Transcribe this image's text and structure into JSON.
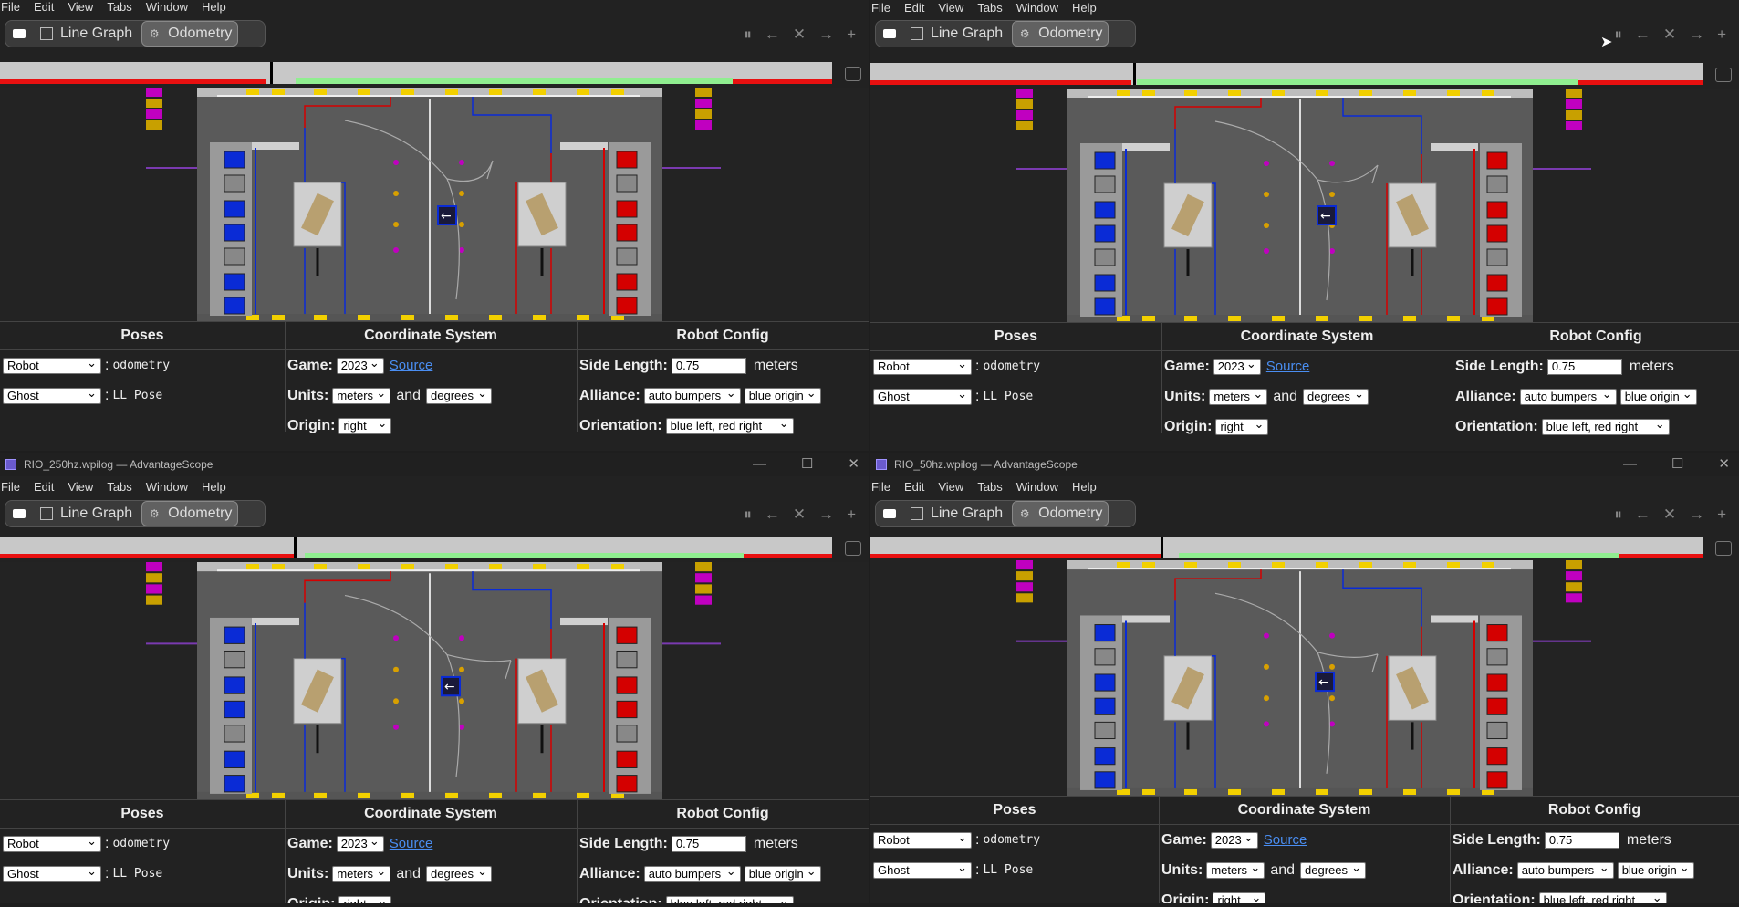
{
  "menu": [
    "File",
    "Edit",
    "View",
    "Tabs",
    "Window",
    "Help"
  ],
  "tabs": {
    "line_graph": "Line Graph",
    "odometry": "Odometry"
  },
  "windows": [
    {
      "title": ""
    },
    {
      "title": ""
    },
    {
      "title": "RIO_250hz.wpilog — AdvantageScope"
    },
    {
      "title": "RIO_50hz.wpilog — AdvantageScope"
    }
  ],
  "panels": {
    "poses": {
      "title": "Poses",
      "rows": [
        {
          "object": "Robot",
          "source": "odometry"
        },
        {
          "object": "Ghost",
          "source": "LL Pose"
        }
      ]
    },
    "coordinate_system": {
      "title": "Coordinate System",
      "game_label": "Game:",
      "game_value": "2023",
      "source_link": "Source",
      "units_label": "Units:",
      "units_dist": "meters",
      "and_text": "and",
      "units_angle": "degrees",
      "origin_label": "Origin:",
      "origin_value": "right"
    },
    "robot_config": {
      "title": "Robot Config",
      "side_length_label": "Side Length:",
      "side_length_value": "0.75",
      "side_length_unit": "meters",
      "alliance_label": "Alliance:",
      "alliance_bumpers": "auto bumpers",
      "alliance_origin": "blue origin",
      "orientation_label": "Orientation:",
      "orientation_value": "blue left, red right"
    }
  },
  "icons": {
    "pause": "pause-icon",
    "back": "arrow-left-icon",
    "close": "close-icon",
    "forward": "arrow-right-icon",
    "add": "plus-icon",
    "robot": "robot-arrow-icon"
  },
  "colors": {
    "blue_alliance": "#0a2bd6",
    "red_alliance": "#d40000",
    "timeline_red": "#e81010",
    "timeline_green": "#90ee90",
    "cone_yellow": "#f2d000",
    "cube_purple": "#c000c0"
  },
  "window_controls": {
    "minimize": "—",
    "maximize": "☐",
    "close": "✕"
  }
}
